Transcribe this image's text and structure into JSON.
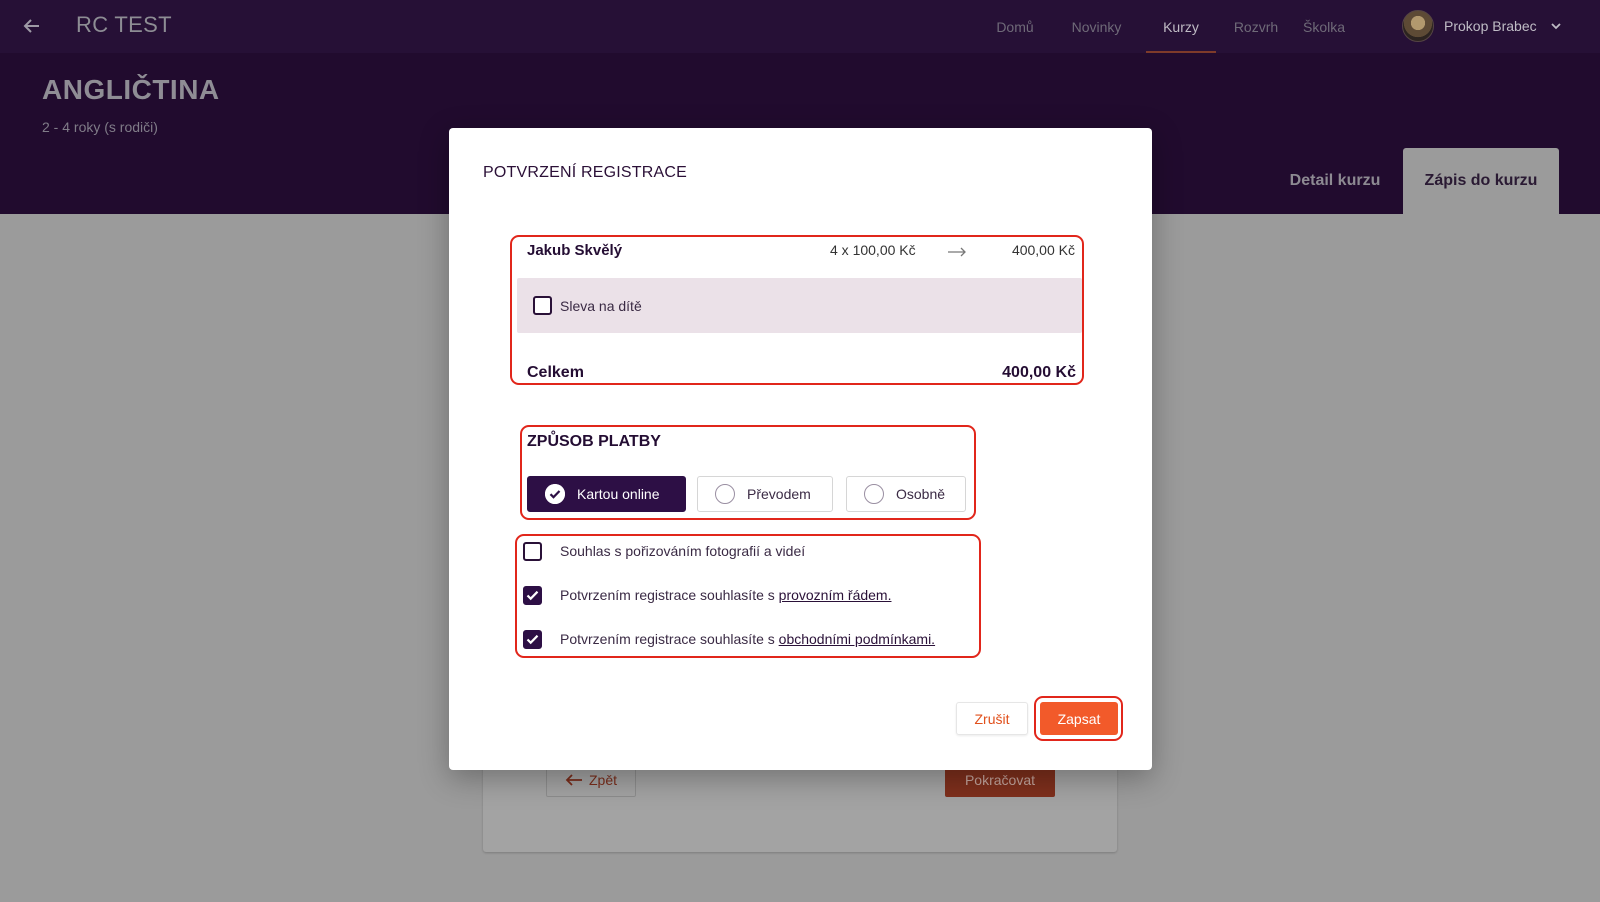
{
  "topbar": {
    "app_title": "RC TEST",
    "nav": [
      "Domů",
      "Novinky",
      "Kurzy",
      "Rozvrh",
      "Školka"
    ],
    "active_nav": "Kurzy",
    "user_name": "Prokop Brabec"
  },
  "header": {
    "course_title": "ANGLIČTINA",
    "course_subtitle": "2 - 4 roky (s rodiči)",
    "tabs": [
      "Detail kurzu",
      "Zápis do kurzu"
    ],
    "active_tab": "Zápis do kurzu"
  },
  "background": {
    "back_label": "Zpět",
    "next_label": "Pokračovat"
  },
  "modal": {
    "title": "POTVRZENÍ REGISTRACE",
    "summary": {
      "child_name": "Jakub Skvělý",
      "calculation": "4 x 100,00 Kč",
      "line_total": "400,00 Kč",
      "discount_label": "Sleva na dítě",
      "discount_checked": false,
      "total_label": "Celkem",
      "total_value": "400,00 Kč"
    },
    "payment": {
      "title": "ZPŮSOB PLATBY",
      "options": [
        "Kartou online",
        "Převodem",
        "Osobně"
      ],
      "selected": "Kartou online"
    },
    "consents": [
      {
        "text": "Souhlas s pořizováním fotografií a videí",
        "link": "",
        "checked": false
      },
      {
        "text": "Potvrzením registrace souhlasíte s ",
        "link": "provozním řádem.",
        "checked": true
      },
      {
        "text": "Potvrzením registrace souhlasíte s ",
        "link": "obchodními podmínkami.",
        "checked": true
      }
    ],
    "cancel_label": "Zrušit",
    "submit_label": "Zapsat"
  },
  "colors": {
    "primary": "#2d0f45",
    "accent": "#f25a2a",
    "highlight": "#e1261b"
  }
}
